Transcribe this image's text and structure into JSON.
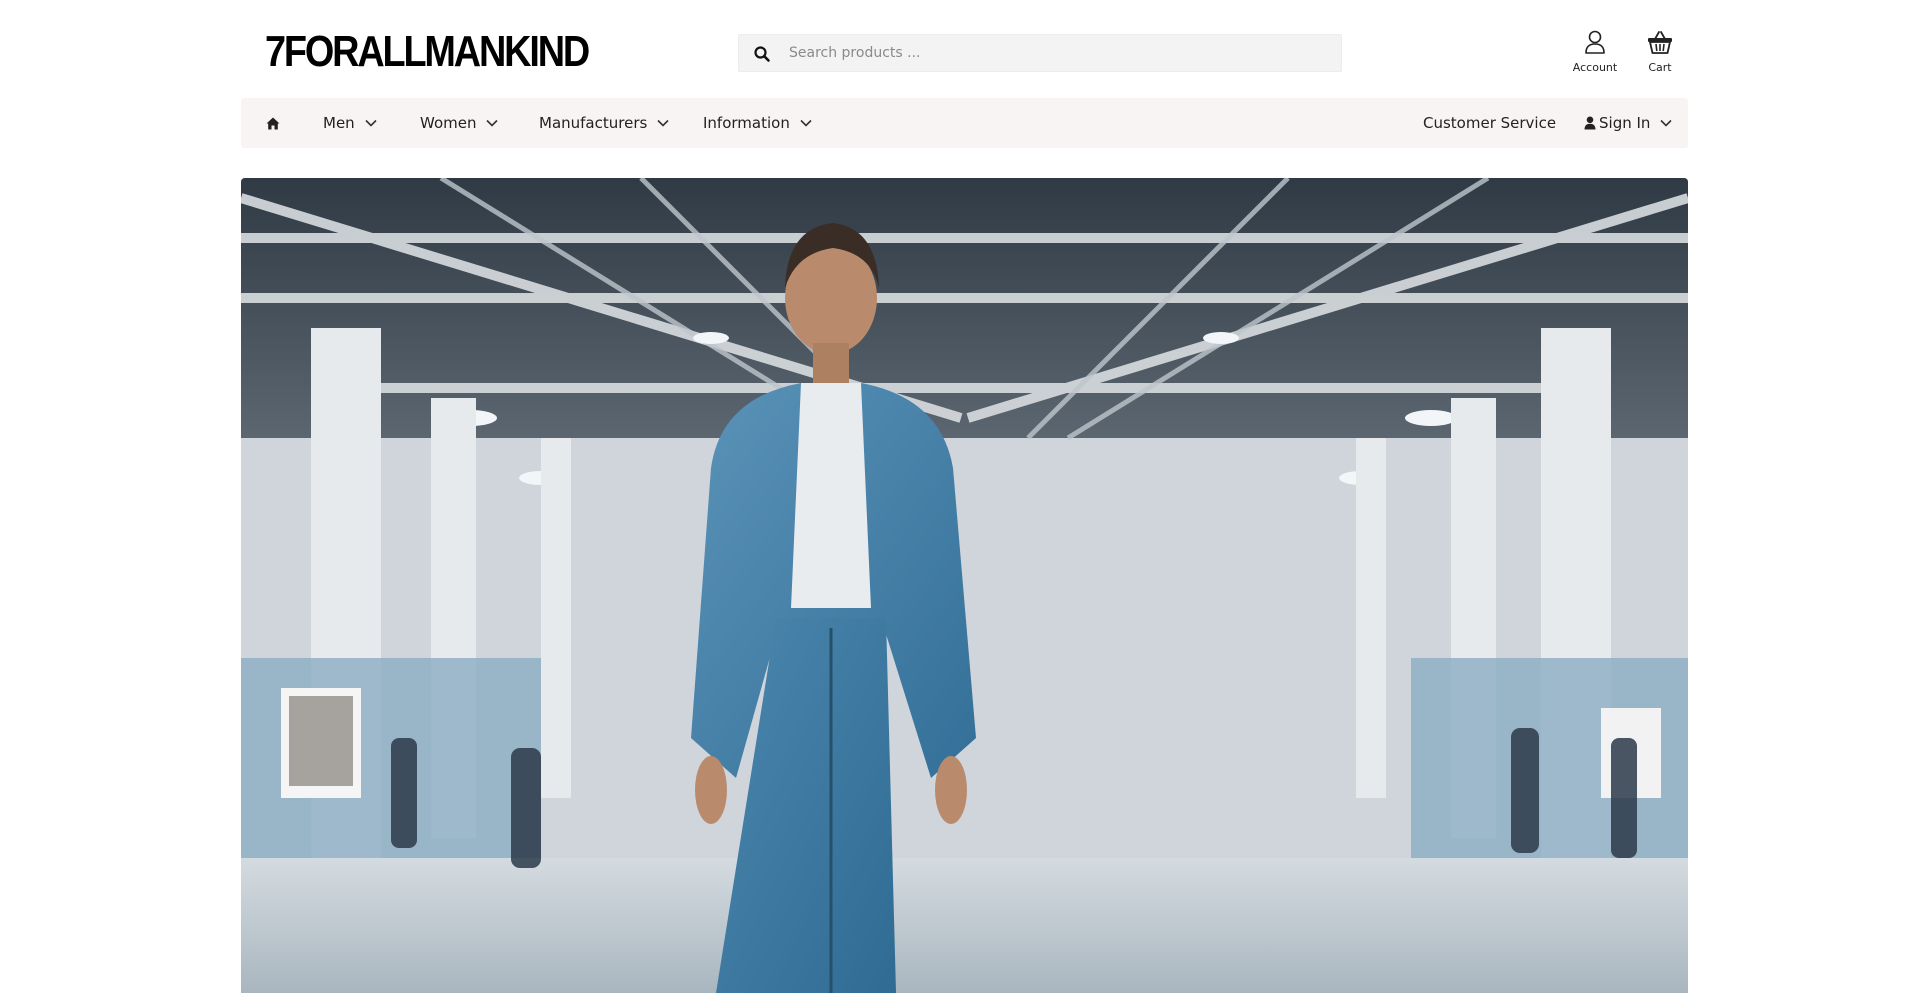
{
  "header": {
    "logo_text": "7FORALLMANKIND",
    "search": {
      "placeholder": "Search products ...",
      "value": "",
      "icon": "search-icon"
    },
    "account": {
      "label": "Account",
      "icon": "user-outline-icon"
    },
    "cart": {
      "label": "Cart",
      "icon": "basket-icon"
    }
  },
  "nav": {
    "home_icon": "home-icon",
    "items": [
      {
        "label": "Men"
      },
      {
        "label": "Women"
      },
      {
        "label": "Manufacturers"
      },
      {
        "label": "Information"
      }
    ],
    "customer_service": "Customer Service",
    "sign_in": "Sign In"
  },
  "hero": {
    "image": "woman in denim jacket and jeans standing in exhibition hall",
    "colors": {
      "denim": "#3f7fa6",
      "shirt": "#e8ecef",
      "floor": "#c4cdd3"
    }
  }
}
